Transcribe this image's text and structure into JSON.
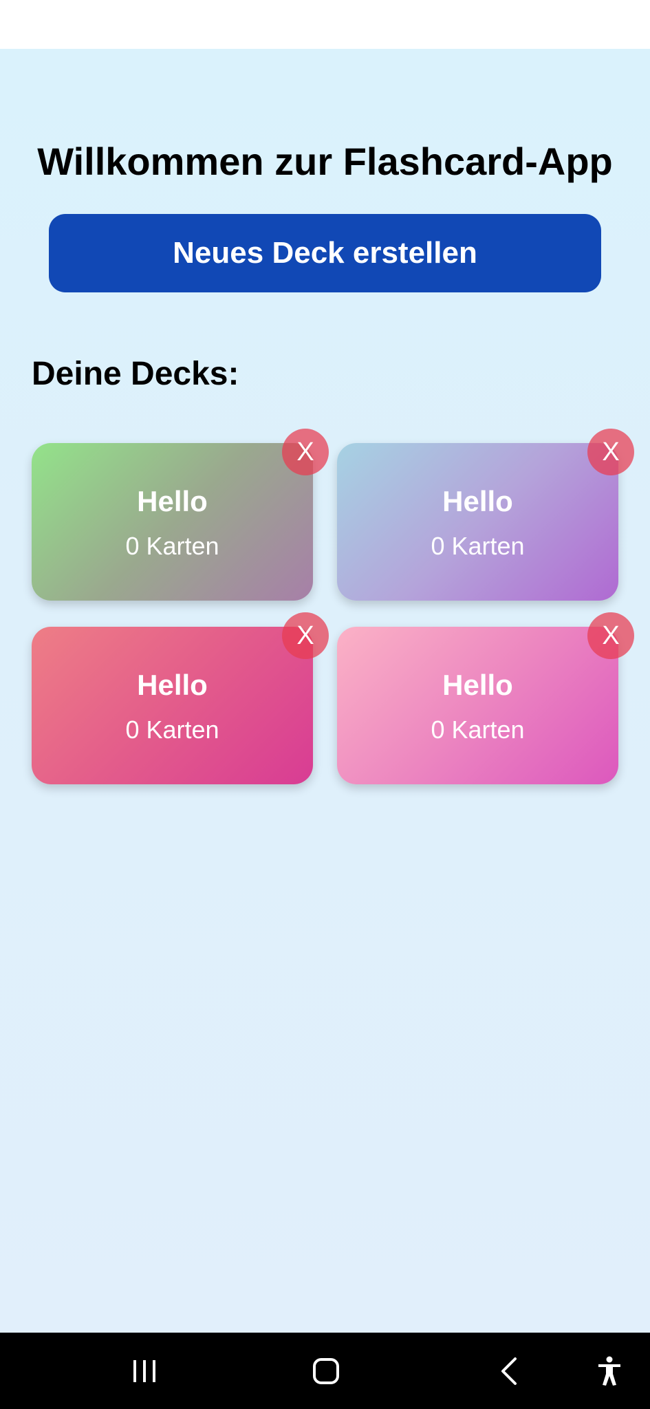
{
  "app": {
    "title": "Willkommen zur Flashcard-App",
    "new_deck_label": "Neues Deck erstellen",
    "decks_heading": "Deine Decks:",
    "delete_label": "X",
    "accent_color": "#1148b5"
  },
  "decks": [
    {
      "name": "Hello",
      "count": "0 Karten",
      "gradient": [
        "#93e38a",
        "#a77fa8"
      ]
    },
    {
      "name": "Hello",
      "count": "0 Karten",
      "gradient": [
        "#a6d2e3",
        "#b06ad2"
      ]
    },
    {
      "name": "Hello",
      "count": "0 Karten",
      "gradient": [
        "#ee7e86",
        "#d83c94"
      ]
    },
    {
      "name": "Hello",
      "count": "0 Karten",
      "gradient": [
        "#fbb2c6",
        "#dc58be"
      ]
    }
  ],
  "navigation": {
    "buttons": [
      "recent-apps-icon",
      "home-icon",
      "back-icon",
      "accessibility-icon"
    ]
  }
}
